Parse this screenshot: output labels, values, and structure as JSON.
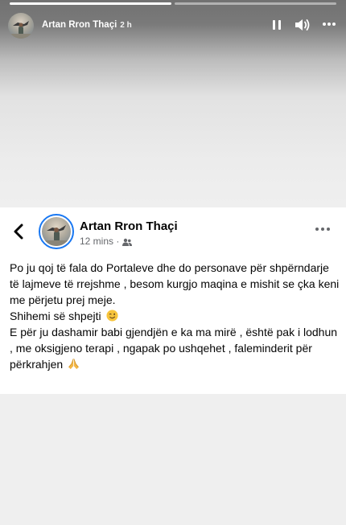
{
  "story": {
    "author": "Artan Rron Thaçi",
    "time": "2 h",
    "progress": [
      1.0,
      0.0
    ],
    "controls": [
      "pause-icon",
      "volume-icon",
      "more-options-icon"
    ]
  },
  "post": {
    "author": "Artan Rron Thaçi",
    "time": "12 mins ·",
    "audience_icon": "friends-icon",
    "paragraphs": [
      "Po ju qoj të fala do Portaleve dhe do personave për shpërndarje të lajmeve të rrejshme , besom kurgjo maqina e mishit se çka keni me përjetu prej meje.",
      "Shihemi së shpejti",
      "E për ju dashamir babi gjendjën e ka ma mirë , është pak i lodhun , me oksigjeno terapi , ngapak po ushqehet , faleminderit për përkrahjen"
    ],
    "emojis": [
      "winking-face-emoji",
      "folded-hands-emoji"
    ]
  },
  "colors": {
    "accent": "#1877f2",
    "text": "#050505",
    "meta": "#65676b"
  }
}
